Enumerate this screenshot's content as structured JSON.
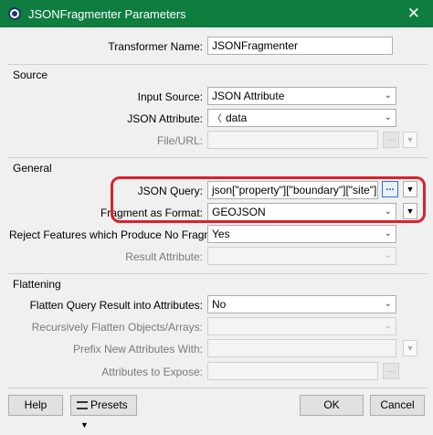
{
  "window": {
    "title": "JSONFragmenter Parameters"
  },
  "transformer_name": {
    "label": "Transformer Name:",
    "value": "JSONFragmenter"
  },
  "source": {
    "heading": "Source",
    "input_source": {
      "label": "Input Source:",
      "value": "JSON Attribute"
    },
    "json_attribute": {
      "label": "JSON Attribute:",
      "value": "data"
    },
    "file_url": {
      "label": "File/URL:",
      "value": ""
    }
  },
  "general": {
    "heading": "General",
    "json_query": {
      "label": "JSON Query:",
      "value": "json[\"property\"][\"boundary\"][\"site\"]"
    },
    "fragment_format": {
      "label": "Fragment as Format:",
      "value": "GEOJSON"
    },
    "reject_features": {
      "label": "Reject Features which Produce No Fragments:",
      "value": "Yes"
    },
    "result_attribute": {
      "label": "Result Attribute:",
      "value": ""
    }
  },
  "flattening": {
    "heading": "Flattening",
    "flatten_query": {
      "label": "Flatten Query Result into Attributes:",
      "value": "No"
    },
    "recursively_flatten": {
      "label": "Recursively Flatten Objects/Arrays:",
      "value": ""
    },
    "prefix_attributes": {
      "label": "Prefix New Attributes With:",
      "value": ""
    },
    "attributes_expose": {
      "label": "Attributes to Expose:",
      "value": ""
    }
  },
  "buttons": {
    "help": "Help",
    "presets": "Presets",
    "ok": "OK",
    "cancel": "Cancel"
  },
  "glyphs": {
    "dots": "...",
    "arrow_down": "▼",
    "chevron": "⌄",
    "close": "✕",
    "attr_tag": "〈"
  },
  "colors": {
    "titlebar": "#0e7d3f",
    "highlight": "#d9232e"
  }
}
